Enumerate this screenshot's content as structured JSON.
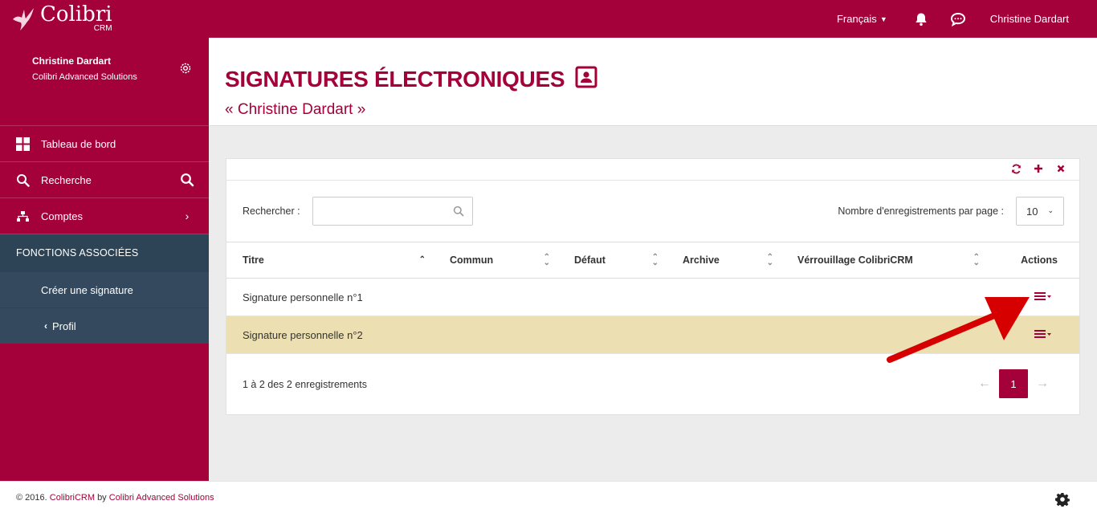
{
  "app": {
    "brand_name": "Colibri",
    "brand_sub": "CRM"
  },
  "topbar": {
    "language": "Français",
    "user_name": "Christine Dardart"
  },
  "sidebar": {
    "profile_name": "Christine Dardart",
    "profile_company": "Colibri Advanced Solutions",
    "items": [
      {
        "label": "Tableau de bord",
        "icon": "grid-icon"
      },
      {
        "label": "Recherche",
        "icon": "search-icon"
      },
      {
        "label": "Comptes",
        "icon": "sitemap-icon"
      }
    ],
    "section_title": "FONCTIONS ASSOCIÉES",
    "sub_items": [
      {
        "label": "Créer une signature"
      },
      {
        "label": "Profil"
      }
    ]
  },
  "page": {
    "title": "SIGNATURES ÉLECTRONIQUES",
    "subtitle": "« Christine Dardart »"
  },
  "table_panel": {
    "search_label": "Rechercher :",
    "search_value": "",
    "per_page_label": "Nombre d'enregistrements par page :",
    "per_page_value": "10",
    "columns": [
      "Titre",
      "Commun",
      "Défaut",
      "Archive",
      "Vérrouillage ColibriCRM",
      "Actions"
    ],
    "rows": [
      {
        "titre": "Signature personnelle n°1",
        "commun": "",
        "defaut": "",
        "archive": "",
        "verrouillage": ""
      },
      {
        "titre": "Signature personnelle n°2",
        "commun": "",
        "defaut": "",
        "archive": "",
        "verrouillage": ""
      }
    ],
    "info": "1 à 2 des 2 enregistrements",
    "pager": {
      "prev": "←",
      "current": "1",
      "next": "→"
    }
  },
  "footer": {
    "prefix": "© 2016.",
    "product_link": "ColibriCRM",
    "by": "by",
    "company_link": "Colibri Advanced Solutions"
  },
  "colors": {
    "brand": "#a4003a",
    "sidebar_dark": "#34495e",
    "highlight_row": "#ece0b2"
  }
}
